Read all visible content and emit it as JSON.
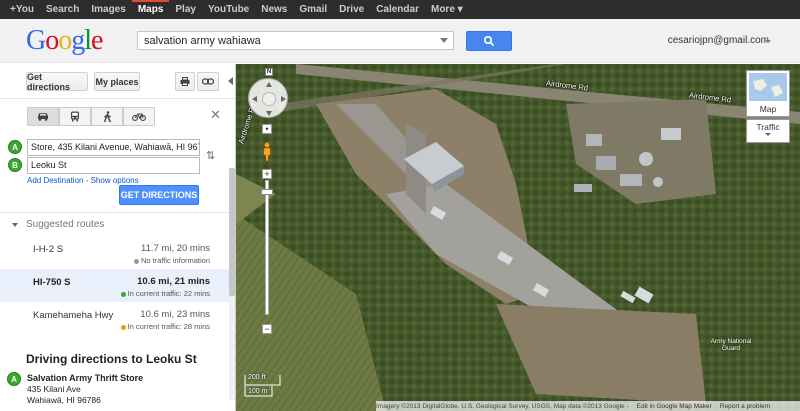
{
  "topnav": [
    {
      "label": "+You",
      "active": false
    },
    {
      "label": "Search",
      "active": false
    },
    {
      "label": "Images",
      "active": false
    },
    {
      "label": "Maps",
      "active": true
    },
    {
      "label": "Play",
      "active": false
    },
    {
      "label": "YouTube",
      "active": false
    },
    {
      "label": "News",
      "active": false
    },
    {
      "label": "Gmail",
      "active": false
    },
    {
      "label": "Drive",
      "active": false
    },
    {
      "label": "Calendar",
      "active": false
    },
    {
      "label": "More ▾",
      "active": false
    }
  ],
  "logo": [
    "G",
    "o",
    "o",
    "g",
    "l",
    "e"
  ],
  "logo_colors": [
    "#3369e8",
    "#d50f25",
    "#eeb211",
    "#3369e8",
    "#009925",
    "#d50f25"
  ],
  "search": {
    "value": "salvation army wahiawa",
    "button_icon": "search-icon"
  },
  "user": {
    "email": "cesariojpn@gmail.com"
  },
  "sidebar": {
    "get_directions_tab": "Get directions",
    "my_places_tab": "My places",
    "print_icon": "print-icon",
    "link_icon": "link-icon",
    "modes": [
      "car-icon",
      "transit-icon",
      "walk-icon",
      "bike-icon"
    ],
    "origin_marker": "A",
    "origin_value": "Store, 435 Kilani Avenue, Wahiawā, HI 96786",
    "dest_marker": "B",
    "dest_value": "Leoku St",
    "add_destination": "Add Destination",
    "separator": " - ",
    "show_options": "Show options",
    "get_directions_btn": "GET DIRECTIONS",
    "suggested_routes": "Suggested routes",
    "routes": [
      {
        "name": "I-H-2 S",
        "dist": "11.7 mi, 20 mins",
        "traffic": "No traffic information",
        "dot": "#999999",
        "selected": false
      },
      {
        "name": "HI-750 S",
        "dist": "10.6 mi, 21 mins",
        "traffic": "In current traffic: 22 mins",
        "dot": "#33aa33",
        "selected": true
      },
      {
        "name": "Kamehameha Hwy",
        "dist": "10.6 mi, 23 mins",
        "traffic": "In current traffic: 28 mins",
        "dot": "#f0a000",
        "selected": false
      }
    ],
    "driving_title": "Driving directions to Leoku St",
    "start": {
      "marker": "A",
      "name": "Salvation Army Thrift Store",
      "line1": "435 Kilani Ave",
      "line2": "Wahiawā, HI 96786"
    }
  },
  "map": {
    "road_label_1": "Airdrome Rd",
    "road_label_2": "Airdrome Rd",
    "road_label_3": "Airdrome Rd",
    "place_label": "Army National Guard",
    "map_type_label": "Map",
    "traffic_label": "Traffic",
    "north": "N",
    "scale_ft": "200 ft",
    "scale_m": "100 m",
    "attribution": "Imagery ©2013 DigitalGlobe, U.S. Geological Survey, USGS, Map data ©2013 Google -",
    "edit_link": "Edit in Google Map Maker",
    "report_link": "Report a problem"
  }
}
